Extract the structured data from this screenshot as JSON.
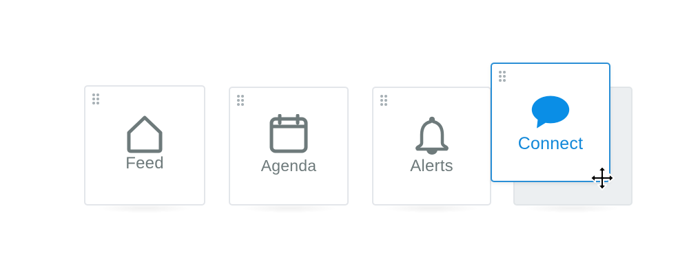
{
  "tiles": [
    {
      "id": "feed",
      "label": "Feed",
      "icon": "home-icon"
    },
    {
      "id": "agenda",
      "label": "Agenda",
      "icon": "calendar-icon"
    },
    {
      "id": "alerts",
      "label": "Alerts",
      "icon": "bell-icon"
    },
    {
      "id": "connect",
      "label": "Connect",
      "icon": "chat-bubble-icon",
      "state": "dragging"
    }
  ],
  "cursor": {
    "type": "move-cursor-icon"
  },
  "colors": {
    "icon_gray": "#6e7a7b",
    "accent_blue": "#1188d9",
    "border": "#e3e6ea",
    "placeholder_bg": "#eceff1"
  }
}
